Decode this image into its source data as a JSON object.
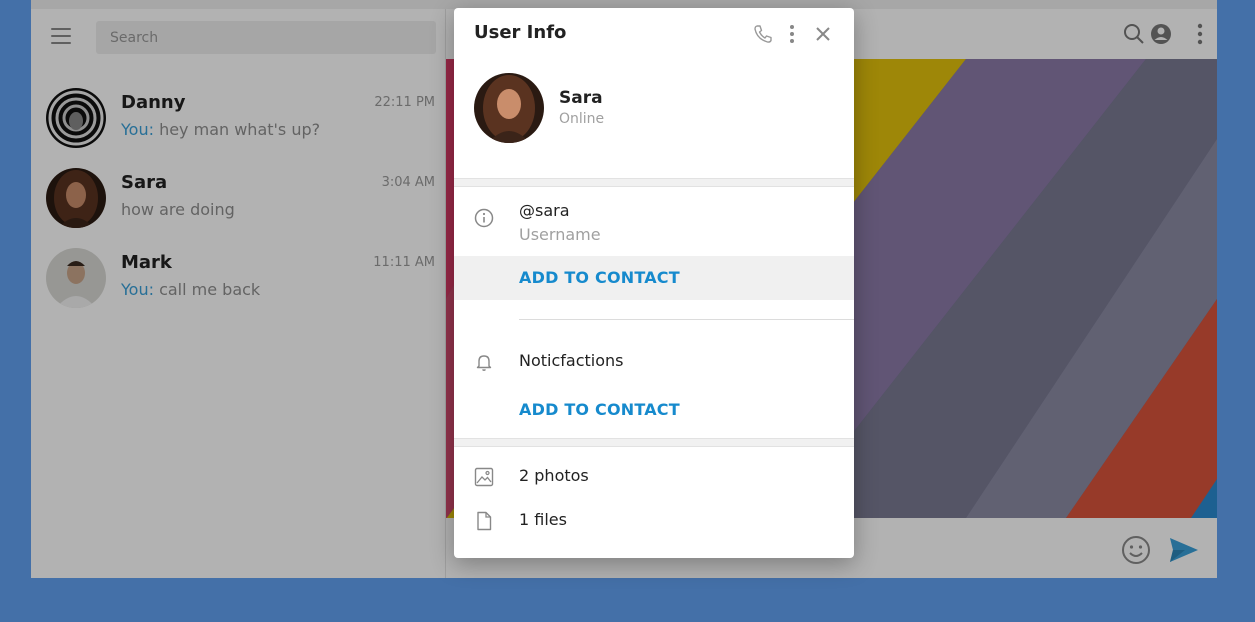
{
  "sidebar": {
    "search_placeholder": "Search",
    "chats": [
      {
        "name": "Danny",
        "time": "22:11 PM",
        "you_prefix": "You:",
        "message": "hey man what's up?"
      },
      {
        "name": "Sara",
        "time": "3:04 AM",
        "you_prefix": "",
        "message": "how are doing"
      },
      {
        "name": "Mark",
        "time": "11:11 AM",
        "you_prefix": "You:",
        "message": "call me back"
      }
    ]
  },
  "header_icons": [
    "search-icon",
    "account-circle-icon",
    "more-vertical-icon"
  ],
  "composer_icons": [
    "emoji-icon",
    "send-icon"
  ],
  "modal": {
    "title": "User Info",
    "action_icons": [
      "phone-icon",
      "more-vertical-icon",
      "close-icon"
    ],
    "profile": {
      "name": "Sara",
      "status": "Online"
    },
    "username": {
      "value": "@sara",
      "label": "Username"
    },
    "add_to_contact_1": "ADD TO CONTACT",
    "notifications_label": "Noticfactions",
    "add_to_contact_2": "ADD TO CONTACT",
    "media": [
      {
        "icon": "image-icon",
        "label": "2 photos"
      },
      {
        "icon": "file-icon",
        "label": "1 files"
      }
    ]
  },
  "colors": {
    "page_background": "#4470a8",
    "accent": "#168acd",
    "you_prefix": "#3aa0d8",
    "send_icon": "#3aa0d8"
  }
}
